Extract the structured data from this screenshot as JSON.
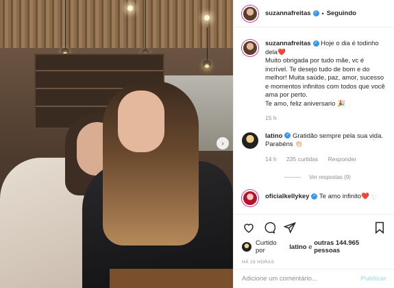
{
  "post": {
    "author": "suzannafreitas",
    "separator": "•",
    "follow_state": "Seguindo",
    "caption": [
      {
        "user": "suzannafreitas",
        "text": " Hoje o dia é todinho dela❤️"
      },
      {
        "text": "Muito obrigada por tudo mãe, vc é incrível. Te desejo tudo de bom e do melhor! Muita saúde, paz, amor, sucesso e momentos infinitos com todos que você ama por perto."
      },
      {
        "text": "Te amo, feliz aniversario 🎉"
      }
    ],
    "caption_time": "15 h"
  },
  "comments": [
    {
      "user": "latino",
      "text": " Gratidão sempre pela sua vida. Parabéns 👏🏻",
      "time": "14 h",
      "likes_label": "235 curtidas",
      "reply_label": "Responder",
      "view_replies": "Ver respostas (9)"
    },
    {
      "user": "oficialkellykey",
      "text": " Te amo infinito❤️"
    }
  ],
  "actions": {
    "icons": [
      "heart-icon",
      "comment-icon",
      "share-icon",
      "bookmark-icon"
    ],
    "likes_prefix": "Curtido por ",
    "likes_user": "latino",
    "likes_middle": " e ",
    "likes_others": "outras 144.965 pessoas",
    "time": "HÁ 15 HORAS"
  },
  "add_comment": {
    "placeholder": "Adicione um comentário...",
    "publish_label": "Publicar"
  },
  "colors": {
    "verified": "#3897f0",
    "publish_disabled": "#b2dffc",
    "muted": "#8e8e8e"
  }
}
